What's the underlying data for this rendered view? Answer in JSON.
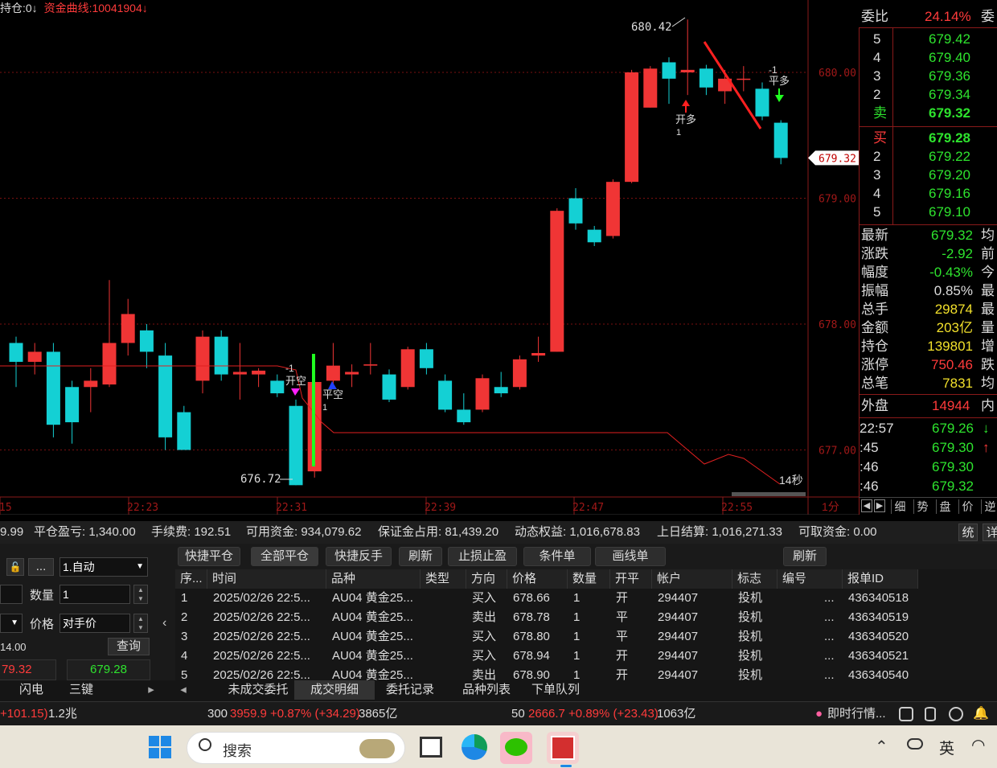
{
  "chart": {
    "legend_position": "持仓:0↓",
    "legend_equity": "资金曲线:10041904↓",
    "price_labels": [
      "680.00",
      "679.00",
      "678.00",
      "677.00"
    ],
    "current_price": "679.32",
    "high_label": "680.42",
    "low_label": "676.72",
    "time_labels": [
      "15",
      "22:23",
      "22:31",
      "22:39",
      "22:47",
      "22:55"
    ],
    "period": "1分",
    "countdown": "14秒",
    "signals": [
      {
        "qty": "-1",
        "text": "开空"
      },
      {
        "qty": "1",
        "text": "平空"
      },
      {
        "qty": "1",
        "text": "开多"
      },
      {
        "qty": "-1",
        "text": "平多"
      }
    ],
    "candles": [
      {
        "o": 677.85,
        "c": 677.7,
        "h": 677.9,
        "l": 677.5
      },
      {
        "o": 677.7,
        "c": 677.78,
        "h": 677.85,
        "l": 677.6
      },
      {
        "o": 677.78,
        "c": 677.2,
        "h": 677.85,
        "l": 677.1
      },
      {
        "o": 677.5,
        "c": 677.22,
        "h": 677.55,
        "l": 677.05
      },
      {
        "o": 677.5,
        "c": 677.55,
        "h": 677.65,
        "l": 677.3
      },
      {
        "o": 677.52,
        "c": 677.85,
        "h": 678.35,
        "l": 677.5
      },
      {
        "o": 677.85,
        "c": 678.08,
        "h": 678.2,
        "l": 677.75
      },
      {
        "o": 677.95,
        "c": 677.78,
        "h": 678.0,
        "l": 677.65
      },
      {
        "o": 677.75,
        "c": 677.1,
        "h": 677.85,
        "l": 677.0
      },
      {
        "o": 677.3,
        "c": 677.0,
        "h": 677.35,
        "l": 677.0
      },
      {
        "o": 677.55,
        "c": 677.9,
        "h": 677.95,
        "l": 677.45
      },
      {
        "o": 677.9,
        "c": 677.6,
        "h": 677.95,
        "l": 677.55
      },
      {
        "o": 677.6,
        "c": 677.62,
        "h": 677.85,
        "l": 677.4
      },
      {
        "o": 677.6,
        "c": 677.63,
        "h": 677.65,
        "l": 677.5
      },
      {
        "o": 677.55,
        "c": 677.45,
        "h": 677.6,
        "l": 677.42
      },
      {
        "o": 677.35,
        "c": 676.72,
        "h": 677.4,
        "l": 676.72
      },
      {
        "o": 676.83,
        "c": 677.54,
        "h": 677.75,
        "l": 676.78
      },
      {
        "o": 677.55,
        "c": 677.67,
        "h": 677.85,
        "l": 677.5
      },
      {
        "o": 677.6,
        "c": 677.62,
        "h": 677.68,
        "l": 677.5
      },
      {
        "o": 677.67,
        "c": 677.68,
        "h": 677.85,
        "l": 677.6
      },
      {
        "o": 677.6,
        "c": 677.4,
        "h": 677.64,
        "l": 677.38
      },
      {
        "o": 677.5,
        "c": 677.8,
        "h": 677.82,
        "l": 677.48
      },
      {
        "o": 677.8,
        "c": 677.65,
        "h": 677.85,
        "l": 677.6
      },
      {
        "o": 677.55,
        "c": 677.32,
        "h": 677.6,
        "l": 677.3
      },
      {
        "o": 677.32,
        "c": 677.22,
        "h": 677.45,
        "l": 677.2
      },
      {
        "o": 677.32,
        "c": 677.57,
        "h": 677.6,
        "l": 677.3
      },
      {
        "o": 677.5,
        "c": 677.45,
        "h": 677.62,
        "l": 677.42
      },
      {
        "o": 677.5,
        "c": 677.72,
        "h": 677.75,
        "l": 677.48
      },
      {
        "o": 677.75,
        "c": 677.77,
        "h": 677.9,
        "l": 677.7
      },
      {
        "o": 677.78,
        "c": 678.9,
        "h": 678.92,
        "l": 677.78
      },
      {
        "o": 679.0,
        "c": 678.8,
        "h": 679.08,
        "l": 678.75
      },
      {
        "o": 678.75,
        "c": 678.65,
        "h": 678.78,
        "l": 678.62
      },
      {
        "o": 678.7,
        "c": 679.13,
        "h": 679.15,
        "l": 678.68
      },
      {
        "o": 679.13,
        "c": 680.0,
        "h": 680.02,
        "l": 679.12
      },
      {
        "o": 679.72,
        "c": 680.03,
        "h": 680.05,
        "l": 679.72
      },
      {
        "o": 680.08,
        "c": 679.95,
        "h": 680.12,
        "l": 679.75
      },
      {
        "o": 680.0,
        "c": 680.02,
        "h": 680.42,
        "l": 679.82
      },
      {
        "o": 680.03,
        "c": 679.88,
        "h": 680.06,
        "l": 679.82
      },
      {
        "o": 679.85,
        "c": 679.95,
        "h": 680.02,
        "l": 679.75
      },
      {
        "o": 679.95,
        "c": 679.95,
        "h": 680.05,
        "l": 679.85
      },
      {
        "o": 679.87,
        "c": 679.65,
        "h": 679.92,
        "l": 679.62
      },
      {
        "o": 679.6,
        "c": 679.32,
        "h": 679.62,
        "l": 679.27
      }
    ],
    "equity_line": [
      677.6,
      677.6,
      677.6,
      677.6,
      677.6,
      677.6,
      677.6,
      677.6,
      677.6,
      677.6,
      677.6,
      677.6,
      677.6,
      677.6,
      677.6,
      677.55,
      677.7,
      677.15,
      677.15,
      677.15,
      677.15,
      677.15,
      677.15,
      677.15,
      677.15,
      677.15,
      677.15,
      677.15,
      677.15,
      677.15,
      677.15,
      677.15,
      677.15,
      677.15,
      677.15,
      677.15,
      677.0,
      676.88,
      676.95,
      676.95,
      676.78,
      676.72
    ]
  },
  "depth": {
    "weibi_label": "委比",
    "weibi_value": "24.14%",
    "weicha_label": "委",
    "asks": [
      {
        "level": "5",
        "price": "679.42"
      },
      {
        "level": "4",
        "price": "679.40"
      },
      {
        "level": "3",
        "price": "679.36"
      },
      {
        "level": "2",
        "price": "679.34"
      },
      {
        "level": "卖",
        "price": "679.32"
      }
    ],
    "bids": [
      {
        "level": "买",
        "price": "679.28"
      },
      {
        "level": "2",
        "price": "679.22"
      },
      {
        "level": "3",
        "price": "679.20"
      },
      {
        "level": "4",
        "price": "679.16"
      },
      {
        "level": "5",
        "price": "679.10"
      }
    ]
  },
  "stats": [
    {
      "label": "最新",
      "value": "679.32",
      "color": "#2ee32e",
      "right": "均"
    },
    {
      "label": "涨跌",
      "value": "-2.92",
      "color": "#2ee32e",
      "right": "前"
    },
    {
      "label": "幅度",
      "value": "-0.43%",
      "color": "#2ee32e",
      "right": "今"
    },
    {
      "label": "振幅",
      "value": "0.85%",
      "color": "#dddddd",
      "right": "最"
    },
    {
      "label": "总手",
      "value": "29874",
      "color": "#f2e02b",
      "right": "最"
    },
    {
      "label": "金额",
      "value": "203亿",
      "color": "#f2e02b",
      "right": "量"
    },
    {
      "label": "持仓",
      "value": "139801",
      "color": "#f2e02b",
      "right": "增"
    },
    {
      "label": "涨停",
      "value": "750.46",
      "color": "#ff3b3b",
      "right": "跌"
    },
    {
      "label": "总笔",
      "value": "7831",
      "color": "#f2e02b",
      "right": "均"
    }
  ],
  "waipan": {
    "label": "外盘",
    "value": "14944",
    "right": "内"
  },
  "ticks": [
    {
      "time": "22:57",
      "price": "679.26",
      "arrow": "↓",
      "color": "#2ee32e"
    },
    {
      "time": ":45",
      "price": "679.30",
      "arrow": "↑",
      "color": "#ff3b3b"
    },
    {
      "time": ":46",
      "price": "679.30",
      "arrow": "",
      "color": ""
    },
    {
      "time": ":46",
      "price": "679.32",
      "arrow": "",
      "color": ""
    }
  ],
  "right_tabs": [
    "细",
    "势",
    "盘",
    "价",
    "逆"
  ],
  "account": {
    "left_value": "9.99",
    "close_profit": "平仓盈亏: 1,340.00",
    "fee": "手续费: 192.51",
    "available": "可用资金: 934,079.62",
    "margin": "保证金占用: 81,439.20",
    "dynamic": "动态权益: 1,016,678.83",
    "settlement": "上日结算: 1,016,271.33",
    "withdraw": "可取资金: 0.00",
    "sys_btn": "统",
    "detail_btn": "详"
  },
  "toolbar": [
    "快捷平仓",
    "全部平仓",
    "快捷反手",
    "刷新",
    "止损止盈",
    "条件单",
    "画线单"
  ],
  "toolbar_refresh": "刷新",
  "form": {
    "mode": "1.自动",
    "qty_label": "数量",
    "qty_value": "1",
    "price_label": "价格",
    "price_value": "对手价",
    "small_value": "14.00",
    "query": "查询",
    "sell_price": "79.32",
    "buy_price": "679.28",
    "dots": "...",
    "tabs": [
      "闪电",
      "三键"
    ]
  },
  "table": {
    "headers": [
      "序...",
      "时间",
      "品种",
      "类型",
      "方向",
      "价格",
      "数量",
      "开平",
      "帐户",
      "标志",
      "编号",
      "报单ID"
    ],
    "rows": [
      [
        "1",
        "2025/02/26 22:5...",
        "AU04 黄金25...",
        "",
        "买入",
        "678.66",
        "1",
        "开",
        "294407",
        "投机",
        "...",
        "436340518"
      ],
      [
        "2",
        "2025/02/26 22:5...",
        "AU04 黄金25...",
        "",
        "卖出",
        "678.78",
        "1",
        "平",
        "294407",
        "投机",
        "...",
        "436340519"
      ],
      [
        "3",
        "2025/02/26 22:5...",
        "AU04 黄金25...",
        "",
        "买入",
        "678.80",
        "1",
        "平",
        "294407",
        "投机",
        "...",
        "436340520"
      ],
      [
        "4",
        "2025/02/26 22:5...",
        "AU04 黄金25...",
        "",
        "买入",
        "678.94",
        "1",
        "开",
        "294407",
        "投机",
        "...",
        "436340521"
      ],
      [
        "5",
        "2025/02/26 22:5...",
        "AU04 黄金25...",
        "",
        "卖出",
        "678.90",
        "1",
        "开",
        "294407",
        "投机",
        "...",
        "436340540"
      ]
    ]
  },
  "bottom_tabs": [
    "未成交委托",
    "成交明细",
    "委托记录",
    "品种列表",
    "下单队列"
  ],
  "status": {
    "s1": "+101.15)",
    "s1b": "1.2兆",
    "s2a": "300",
    "s2b": "3959.9 +0.87% (+34.29)",
    "s2c": "3865亿",
    "s3a": "50",
    "s3b": "2666.7 +0.89% (+23.43)",
    "s3c": "1063亿",
    "quote": "即时行情..."
  },
  "taskbar": {
    "search": "搜索",
    "ime": "英"
  }
}
